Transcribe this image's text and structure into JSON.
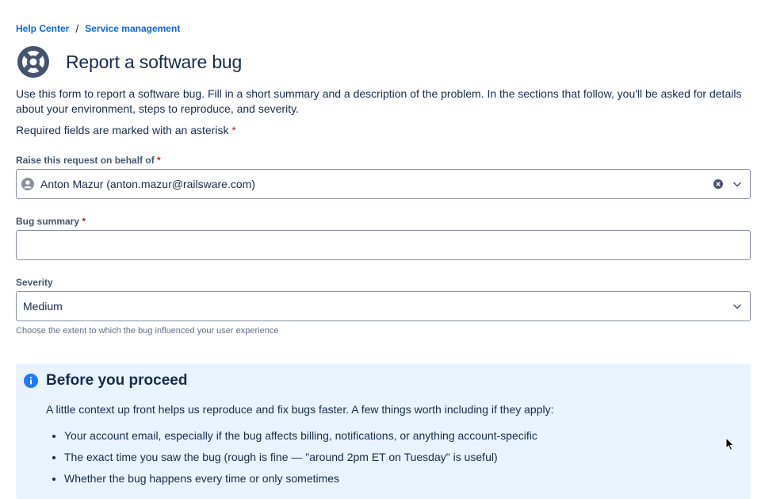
{
  "breadcrumb": {
    "home": "Help Center",
    "separator": "/",
    "current": "Service management"
  },
  "page": {
    "title": "Report a software bug",
    "icon": "lifebuoy-icon",
    "intro": "Use this form to report a software bug. Fill in a short summary and a description of the problem. In the sections that follow, you'll be asked for details about your environment, steps to reproduce, and severity.",
    "required_note": "Required fields are marked with an asterisk",
    "asterisk": "*"
  },
  "fields": {
    "on_behalf": {
      "label": "Raise this request on behalf of",
      "value": "Anton Mazur (anton.mazur@railsware.com)"
    },
    "summary": {
      "label": "Bug summary",
      "value": ""
    },
    "severity": {
      "label": "Severity",
      "value": "Medium",
      "helper": "Choose the extent to which the bug influenced your user experience"
    }
  },
  "panel": {
    "title": "Before you proceed",
    "text": "A little context up front helps us reproduce and fix bugs faster. A few things worth including if they apply:",
    "items": [
      "Your account email, especially if the bug affects billing, notifications, or anything account-specific",
      "The exact time you saw the bug (rough is fine — \"around 2pm ET on Tuesday\" is useful)",
      "Whether the bug happens every time or only sometimes"
    ]
  },
  "colors": {
    "link": "#0c66e4",
    "asterisk": "#ae2e24",
    "panel_bg": "#e9f2ff",
    "info_icon": "#1d7afc",
    "title_icon": "#44546f"
  }
}
